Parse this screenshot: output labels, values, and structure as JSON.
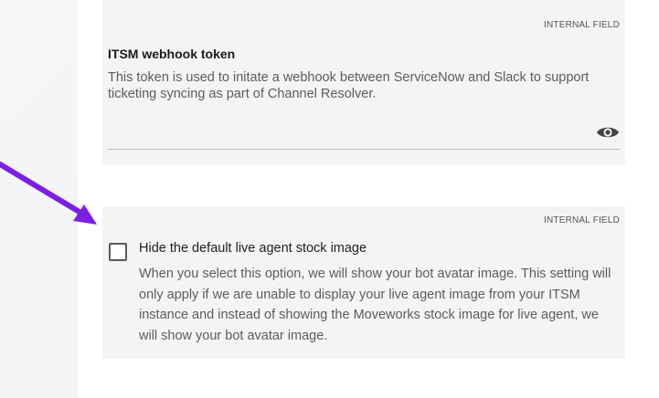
{
  "colors": {
    "card_background": "#f4f4f5",
    "arrow": "#7b1fe0",
    "text_primary": "#1b1b1d",
    "text_secondary": "#5c5c60"
  },
  "itsm_token_card": {
    "tag": "INTERNAL FIELD",
    "title": "ITSM webhook token",
    "description": "This token is used to initate a webhook between ServiceNow and Slack to support ticketing syncing as part of Channel Resolver.",
    "input_value": "",
    "visibility_icon": "eye-icon"
  },
  "live_agent_image_card": {
    "tag": "INTERNAL FIELD",
    "checkbox_checked": false,
    "label": "Hide the default live agent stock image",
    "description": "When you select this option, we will show your bot avatar image. This setting will only apply if we are unable to display your live agent image from your ITSM instance and instead of showing the Moveworks stock image for live agent, we will show your bot avatar image."
  },
  "annotation": {
    "icon": "arrow-pointer-icon"
  }
}
